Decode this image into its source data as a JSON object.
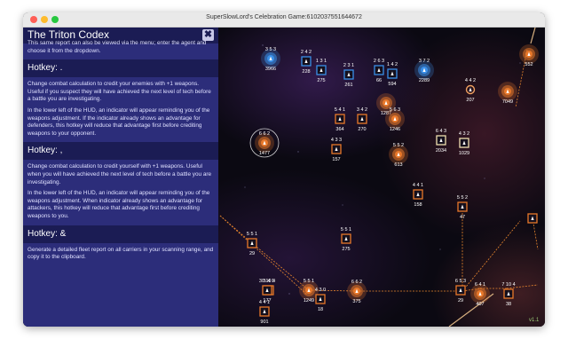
{
  "window": {
    "title": "SuperSlowLord's Celebration Game:6102037551644672"
  },
  "codex": {
    "title": "The Triton Codex",
    "close_label": "✖",
    "intro": "This same report can also be viewed via the menu; enter the agent and choose it from the dropdown.",
    "sections": [
      {
        "heading": "Hotkey: .",
        "paragraphs": [
          "Change combat calculation to credit your enemies with +1 weapons. Useful if you suspect they will have achieved the next level of tech before a battle you are investigating.",
          "In the lower left of the HUD, an indicator will appear reminding you of the weapons adjustment. If the indicator already shows an advantage for defenders, this hotkey will reduce that advantage first before crediting weapons to your opponent."
        ]
      },
      {
        "heading": "Hotkey: ,",
        "paragraphs": [
          "Change combat calculation to credit yourself with +1 weapons. Useful when you will have achieved the next level of tech before a battle you are investigating.",
          "In the lower left of the HUD, an indicator will appear reminding you of the weapons adjustment. When indicator already shows an advantage for attackers, this hotkey will reduce that advantage first before crediting weapons to you."
        ]
      },
      {
        "heading": "Hotkey: &",
        "paragraphs": [
          "Generate a detailed fleet report on all carriers in your scanning range, and copy it to the clipboard."
        ]
      }
    ]
  },
  "map": {
    "version": "v1.1",
    "stars": [
      {
        "stats": "3 5 3",
        "ships": "3966",
        "kind": "blue"
      },
      {
        "stats": "2 4 2",
        "ships": "228",
        "kind": "sq-blue"
      },
      {
        "stats": "1 3 1",
        "ships": "275",
        "kind": "sq-blue"
      },
      {
        "stats": "2 3 1",
        "ships": "261",
        "kind": "sq-blue"
      },
      {
        "stats": "2 6 3",
        "ships": "66",
        "kind": "sq-blue"
      },
      {
        "stats": "1 4 2",
        "ships": "594",
        "kind": "sq-blue"
      },
      {
        "stats": "3 7 2",
        "ships": "2289",
        "kind": "blue"
      },
      {
        "stats": "4 4 2",
        "ships": "207",
        "kind": "ring"
      },
      {
        "stats": "",
        "ships": "552",
        "kind": "orange"
      },
      {
        "stats": "",
        "ships": "7049",
        "kind": "orange"
      },
      {
        "stats": "",
        "ships": "1287",
        "kind": "orange"
      },
      {
        "stats": "5 4 1",
        "ships": "364",
        "kind": "sq"
      },
      {
        "stats": "3 4 2",
        "ships": "270",
        "kind": "sq"
      },
      {
        "stats": "5 6 3",
        "ships": "1246",
        "kind": "orange"
      },
      {
        "stats": "6 6 2",
        "ships": "1477",
        "kind": "orange"
      },
      {
        "stats": "4 3 3",
        "ships": "157",
        "kind": "sq"
      },
      {
        "stats": "5 5 2",
        "ships": "613",
        "kind": "orange"
      },
      {
        "stats": "6 4 3",
        "ships": "2034",
        "kind": "sq-white"
      },
      {
        "stats": "4 3 2",
        "ships": "1029",
        "kind": "sq-white"
      },
      {
        "stats": "4 4 1",
        "ships": "158",
        "kind": "sq"
      },
      {
        "stats": "5 5 2",
        "ships": "47",
        "kind": "sq"
      },
      {
        "stats": "5 5 1",
        "ships": "275",
        "kind": "sq"
      },
      {
        "stats": "5 5 1",
        "ships": "29",
        "kind": "sq"
      },
      {
        "stats": "5 4 1",
        "ships": "",
        "kind": "sq"
      },
      {
        "stats": "30 10 4",
        "ships": "177",
        "kind": "sq"
      },
      {
        "stats": "5 5 1",
        "ships": "1249",
        "kind": "orange"
      },
      {
        "stats": "4 3 0",
        "ships": "18",
        "kind": "sq"
      },
      {
        "stats": "6 6 2",
        "ships": "375",
        "kind": "orange"
      },
      {
        "stats": "4 4 1",
        "ships": "901",
        "kind": "sq"
      },
      {
        "stats": "6 5 3",
        "ships": "29",
        "kind": "sq"
      },
      {
        "stats": "6 4 1",
        "ships": "407",
        "kind": "orange"
      },
      {
        "stats": "7 10 4",
        "ships": "38",
        "kind": "sq"
      },
      {
        "stats": "",
        "ships": "",
        "kind": "sq"
      }
    ]
  }
}
